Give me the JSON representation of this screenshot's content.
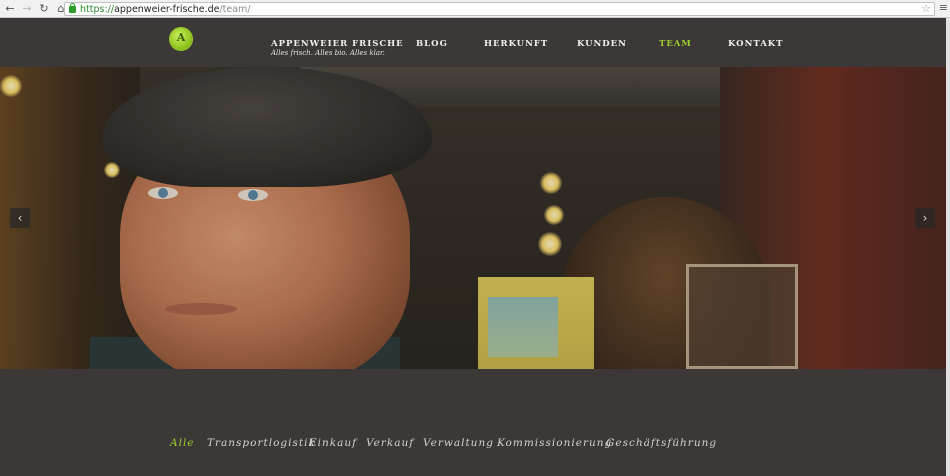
{
  "browser": {
    "url_scheme": "https://",
    "url_host": "appenweier-frische.de",
    "url_path": "/team/",
    "back": "←",
    "forward": "→",
    "reload": "↻",
    "home": "⌂",
    "star": "☆",
    "menu": "≡"
  },
  "site": {
    "logo_letter": "A",
    "brand_title": "APPENWEIER FRISCHE",
    "brand_tagline": "Alles frisch. Alles bio. Alles klar.",
    "nav": {
      "blog": "BLOG",
      "herkunft": "HERKUNFT",
      "kunden": "KUNDEN",
      "team": "TEAM",
      "kontakt": "KONTAKT"
    },
    "active_nav": "team"
  },
  "hero": {
    "prev_arrow": "‹",
    "next_arrow": "›"
  },
  "filters": {
    "alle": "Alle",
    "transportlogistik": "Transportlogistik",
    "einkauf": "Einkauf",
    "verkauf": "Verkauf",
    "verwaltung": "Verwaltung",
    "kommissionierung": "Kommissionierung",
    "geschaeftsfuehrung": "Geschäftsführung"
  },
  "colors": {
    "accent": "#9ccf2a",
    "background": "#3b3837",
    "text": "#f2f0ea"
  }
}
